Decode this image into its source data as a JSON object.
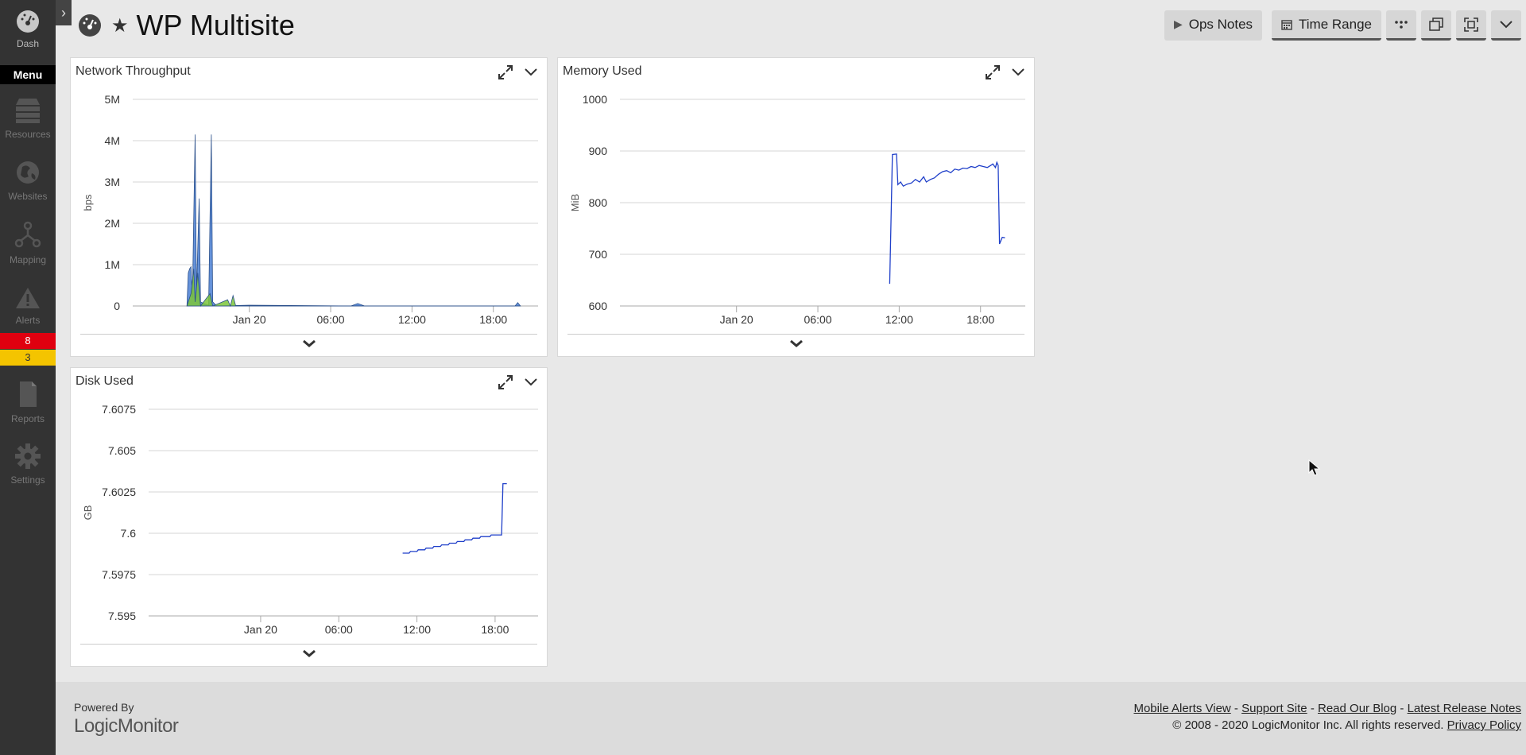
{
  "sidebar": {
    "dash_label": "Dash",
    "menu_label": "Menu",
    "items": [
      {
        "label": "Resources",
        "icon": "resources-icon"
      },
      {
        "label": "Websites",
        "icon": "globe-icon"
      },
      {
        "label": "Mapping",
        "icon": "mapping-icon"
      },
      {
        "label": "Alerts",
        "icon": "alert-icon"
      },
      {
        "label": "Reports",
        "icon": "report-icon"
      },
      {
        "label": "Settings",
        "icon": "gear-icon"
      }
    ],
    "alert_counts": {
      "critical": "8",
      "warning": "3"
    },
    "alert_colors": {
      "critical": "#e0000f",
      "warning": "#f4c400"
    }
  },
  "header": {
    "title": "WP Multisite",
    "ops_notes_label": "Ops Notes",
    "time_range_label": "Time Range"
  },
  "widgets": [
    {
      "title": "Network Throughput",
      "chart_data": {
        "type": "area",
        "ylabel": "bps",
        "y_ticks": [
          "5M",
          "4M",
          "3M",
          "2M",
          "1M",
          "0"
        ],
        "ylim": [
          0,
          5000000
        ],
        "x_ticks": [
          "Jan 20",
          "06:00",
          "12:00",
          "18:00"
        ],
        "series": [
          {
            "color": "#4a7fd4",
            "points": [
              [
                -4.6,
                0
              ],
              [
                -4.5,
                800000
              ],
              [
                -4.4,
                900000
              ],
              [
                -4.3,
                950000
              ],
              [
                -4.2,
                200000
              ],
              [
                -4.0,
                4150000
              ],
              [
                -3.9,
                300000
              ],
              [
                -3.7,
                2600000
              ],
              [
                -3.6,
                100000
              ],
              [
                -3.3,
                50000
              ],
              [
                -3.0,
                20000
              ],
              [
                -2.8,
                4150000
              ],
              [
                -2.7,
                100000
              ],
              [
                -2.4,
                0
              ],
              [
                0,
                20000
              ],
              [
                7.5,
                0
              ],
              [
                8,
                60000
              ],
              [
                8.5,
                0
              ],
              [
                19.6,
                0
              ],
              [
                19.8,
                80000
              ],
              [
                20,
                0
              ]
            ]
          },
          {
            "color": "#7cc63a",
            "points": [
              [
                -4.6,
                0
              ],
              [
                -4.3,
                300000
              ],
              [
                -4.1,
                900000
              ],
              [
                -4.0,
                100000
              ],
              [
                -3.8,
                800000
              ],
              [
                -3.6,
                0
              ],
              [
                -2.9,
                300000
              ],
              [
                -2.7,
                0
              ],
              [
                -1.6,
                150000
              ],
              [
                -1.4,
                0
              ],
              [
                -1.2,
                250000
              ],
              [
                -1.0,
                0
              ],
              [
                20,
                0
              ]
            ]
          }
        ]
      }
    },
    {
      "title": "Memory Used",
      "chart_data": {
        "type": "line",
        "ylabel": "MiB",
        "y_ticks": [
          "1000",
          "900",
          "800",
          "700",
          "600"
        ],
        "ylim": [
          600,
          1000
        ],
        "x_ticks": [
          "Jan 20",
          "06:00",
          "12:00",
          "18:00"
        ],
        "series": [
          {
            "color": "#1f3fc9",
            "points": [
              [
                11.3,
                643
              ],
              [
                11.5,
                893
              ],
              [
                11.8,
                894
              ],
              [
                11.9,
                835
              ],
              [
                12.1,
                840
              ],
              [
                12.3,
                832
              ],
              [
                12.6,
                836
              ],
              [
                12.9,
                838
              ],
              [
                13.2,
                845
              ],
              [
                13.5,
                840
              ],
              [
                13.8,
                850
              ],
              [
                14.0,
                840
              ],
              [
                14.3,
                845
              ],
              [
                14.6,
                848
              ],
              [
                14.9,
                855
              ],
              [
                15.2,
                860
              ],
              [
                15.5,
                862
              ],
              [
                15.8,
                858
              ],
              [
                16.1,
                865
              ],
              [
                16.4,
                863
              ],
              [
                16.7,
                867
              ],
              [
                17.0,
                866
              ],
              [
                17.3,
                870
              ],
              [
                17.6,
                868
              ],
              [
                17.9,
                872
              ],
              [
                18.2,
                870
              ],
              [
                18.5,
                868
              ],
              [
                18.8,
                873
              ],
              [
                18.9,
                875
              ],
              [
                19.1,
                868
              ],
              [
                19.2,
                878
              ],
              [
                19.3,
                872
              ],
              [
                19.4,
                720
              ],
              [
                19.6,
                733
              ],
              [
                19.8,
                732
              ]
            ]
          }
        ]
      }
    },
    {
      "title": "Disk Used",
      "chart_data": {
        "type": "line",
        "ylabel": "GB",
        "y_ticks": [
          "7.6075",
          "7.605",
          "7.6025",
          "7.6",
          "7.5975",
          "7.595"
        ],
        "ylim": [
          7.595,
          7.6075
        ],
        "x_ticks": [
          "Jan 20",
          "06:00",
          "12:00",
          "18:00"
        ],
        "series": [
          {
            "color": "#1f3fc9",
            "points": [
              [
                10.9,
                7.5988
              ],
              [
                11.4,
                7.5988
              ],
              [
                11.5,
                7.5989
              ],
              [
                12.0,
                7.5989
              ],
              [
                12.1,
                7.599
              ],
              [
                12.6,
                7.599
              ],
              [
                12.7,
                7.5991
              ],
              [
                13.2,
                7.5991
              ],
              [
                13.3,
                7.5992
              ],
              [
                13.8,
                7.5992
              ],
              [
                13.9,
                7.5993
              ],
              [
                14.4,
                7.5993
              ],
              [
                14.5,
                7.5994
              ],
              [
                15.0,
                7.5994
              ],
              [
                15.1,
                7.5995
              ],
              [
                15.6,
                7.5995
              ],
              [
                15.7,
                7.5996
              ],
              [
                16.2,
                7.5996
              ],
              [
                16.3,
                7.5997
              ],
              [
                16.8,
                7.5997
              ],
              [
                16.9,
                7.5998
              ],
              [
                17.6,
                7.5998
              ],
              [
                17.7,
                7.5999
              ],
              [
                18.5,
                7.5999
              ],
              [
                18.6,
                7.603
              ],
              [
                18.9,
                7.603
              ]
            ]
          }
        ]
      }
    }
  ],
  "footer": {
    "powered_by": "Powered By",
    "logo_text": "LogicMonitor",
    "links": [
      "Mobile Alerts View",
      "Support Site",
      "Read Our Blog",
      "Latest Release Notes"
    ],
    "separator": " - ",
    "copyright": "© 2008 - 2020 LogicMonitor Inc. All rights reserved.",
    "privacy": "Privacy Policy"
  }
}
